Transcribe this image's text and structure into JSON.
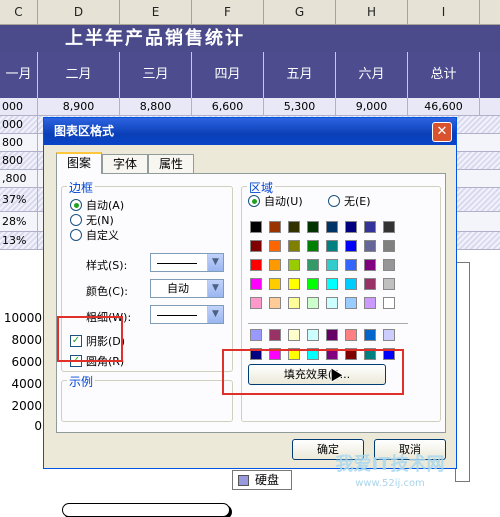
{
  "sheet": {
    "columns": [
      "C",
      "D",
      "E",
      "F",
      "G",
      "H",
      "I"
    ],
    "title": "上半年产品销售统计",
    "months": [
      "一月",
      "二月",
      "三月",
      "四月",
      "五月",
      "六月",
      "总计"
    ],
    "rows": [
      [
        "000",
        "8,900",
        "8,800",
        "6,600",
        "5,300",
        "9,000",
        "46,600"
      ],
      [
        "000",
        "",
        "",
        "",
        "",
        "",
        ""
      ],
      [
        "800",
        "",
        "",
        "",
        "",
        "",
        ""
      ],
      [
        "800",
        "",
        "",
        "",
        "",
        "",
        ""
      ],
      [
        ",800",
        "",
        "",
        "",
        "",
        "",
        ""
      ],
      [
        "37%",
        "",
        "",
        "",
        "",
        "",
        ""
      ],
      [
        "28%",
        "",
        "",
        "",
        "",
        "",
        ""
      ],
      [
        "13%",
        "",
        "",
        "",
        "",
        "",
        ""
      ]
    ],
    "y_axis": [
      "10000",
      "8000",
      "6000",
      "4000",
      "2000",
      "0"
    ],
    "legend_label": "硬盘"
  },
  "dialog": {
    "title": "图表区格式",
    "close_glyph": "✕",
    "tabs": [
      "图案",
      "字体",
      "属性"
    ],
    "border_group": "边框",
    "border_options": [
      {
        "label": "自动(A)",
        "checked": true
      },
      {
        "label": "无(N)",
        "checked": false
      },
      {
        "label": "自定义",
        "checked": false
      }
    ],
    "style_label": "样式(S):",
    "color_label": "颜色(C):",
    "color_value": "自动",
    "weight_label": "粗细(W):",
    "shadow_label": "阴影(D)",
    "round_label": "圆角(R)",
    "sample_label": "示例",
    "area_group": "区域",
    "area_options": [
      {
        "label": "自动(U)",
        "checked": true
      },
      {
        "label": "无(E)",
        "checked": false
      }
    ],
    "fill_effects_button": "填充效果(I)...",
    "ok_button": "确定",
    "cancel_button": "取消"
  },
  "palette": {
    "main": [
      [
        "#000000",
        "#993300",
        "#333300",
        "#003300",
        "#003366",
        "#000080",
        "#333399",
        "#333333"
      ],
      [
        "#800000",
        "#ff6600",
        "#808000",
        "#008000",
        "#008080",
        "#0000ff",
        "#666699",
        "#808080"
      ],
      [
        "#ff0000",
        "#ff9900",
        "#99cc00",
        "#339966",
        "#33cccc",
        "#3366ff",
        "#800080",
        "#969696"
      ],
      [
        "#ff00ff",
        "#ffcc00",
        "#ffff00",
        "#00ff00",
        "#00ffff",
        "#00ccff",
        "#993366",
        "#c0c0c0"
      ],
      [
        "#ff99cc",
        "#ffcc99",
        "#ffff99",
        "#ccffcc",
        "#ccffff",
        "#99ccff",
        "#cc99ff",
        "#ffffff"
      ]
    ],
    "extra": [
      [
        "#9999ff",
        "#993366",
        "#ffffcc",
        "#ccffff",
        "#660066",
        "#ff8080",
        "#0066cc",
        "#ccccff"
      ],
      [
        "#000080",
        "#ff00ff",
        "#ffff00",
        "#00ffff",
        "#800080",
        "#800000",
        "#008080",
        "#0000ff"
      ]
    ]
  },
  "watermark": {
    "text": "我爱IT技术网",
    "url": "www.52ij.com"
  }
}
